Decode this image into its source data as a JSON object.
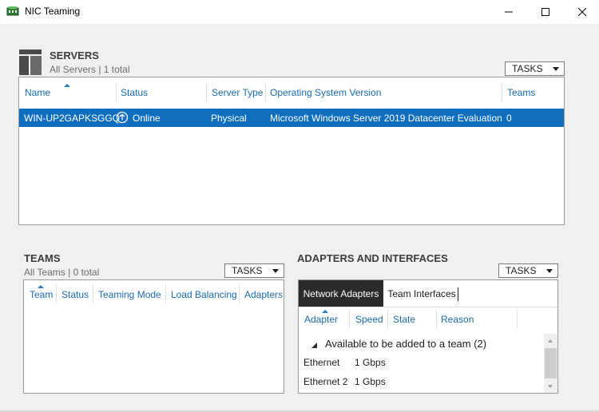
{
  "window": {
    "title": "NIC Teaming",
    "controls": [
      "minimize-icon",
      "maximize-icon",
      "close-icon"
    ]
  },
  "servers": {
    "heading": "SERVERS",
    "subtitle": "All Servers | 1 total",
    "tasks_label": "TASKS",
    "columns": [
      "Name",
      "Status",
      "Server Type",
      "Operating System Version",
      "Teams"
    ],
    "sorted_column": "Name",
    "rows": [
      {
        "name": "WIN-UP2GAPKSGGQ",
        "status": "Online",
        "status_icon": "arrow-up-circle-icon",
        "server_type": "Physical",
        "os_version": "Microsoft Windows Server 2019 Datacenter Evaluation",
        "teams": "0",
        "selected": true
      }
    ]
  },
  "teams": {
    "heading": "TEAMS",
    "subtitle": "All Teams | 0 total",
    "tasks_label": "TASKS",
    "columns": [
      "Team",
      "Status",
      "Teaming Mode",
      "Load Balancing",
      "Adapters"
    ],
    "sorted_column": "Team"
  },
  "adapters": {
    "heading": "ADAPTERS AND INTERFACES",
    "tasks_label": "TASKS",
    "tabs": [
      {
        "label": "Network Adapters",
        "active": true
      },
      {
        "label": "Team Interfaces",
        "active": false
      }
    ],
    "columns": [
      "Adapter",
      "Speed",
      "State",
      "Reason"
    ],
    "sorted_column": "Adapter",
    "group_label": "Available to be added to a team (2)",
    "rows": [
      {
        "adapter": "Ethernet",
        "speed": "1 Gbps"
      },
      {
        "adapter": "Ethernet 2",
        "speed": "1 Gbps"
      }
    ]
  },
  "colors": {
    "selection": "#0e6fc1",
    "header_text": "#1a6cb2",
    "active_tab": "#2b2b2b"
  }
}
